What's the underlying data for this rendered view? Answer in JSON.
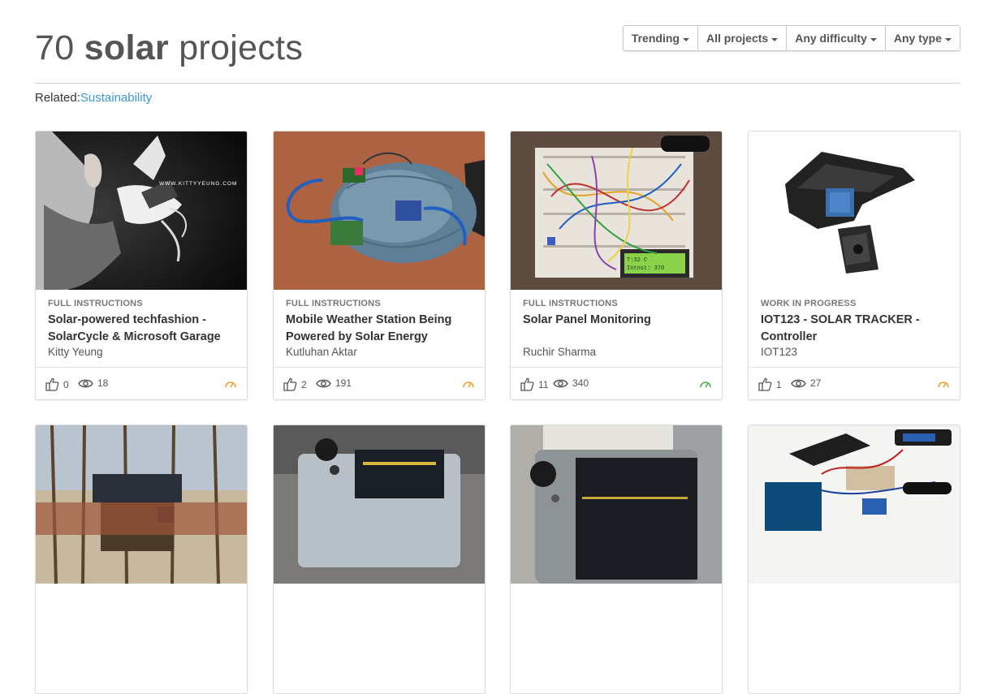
{
  "header": {
    "count": "70",
    "keyword": "solar",
    "suffix": "projects",
    "filters": [
      "Trending",
      "All projects",
      "Any difficulty",
      "Any type"
    ]
  },
  "related": {
    "label": "Related:",
    "link": "Sustainability"
  },
  "cards": [
    {
      "kind": "FULL INSTRUCTIONS",
      "title": "Solar-powered techfashion - SolarCycle & Microsoft Garage",
      "author": "Kitty Yeung",
      "likes": "0",
      "views": "18",
      "thumb_text": "WWW.KITTYYEUNG.COM",
      "indicator_color": "#f0a030"
    },
    {
      "kind": "FULL INSTRUCTIONS",
      "title": "Mobile Weather Station Being Powered by Solar Energy",
      "author": "Kutluhan Aktar",
      "likes": "2",
      "views": "191",
      "indicator_color": "#f0a030"
    },
    {
      "kind": "FULL INSTRUCTIONS",
      "title": "Solar Panel Monitoring",
      "author": "Ruchir Sharma",
      "likes": "11",
      "views": "340",
      "lcd_line1": "T:32 C",
      "lcd_line2": "Intnst: 370",
      "indicator_color": "#4caf50"
    },
    {
      "kind": "WORK IN PROGRESS",
      "title": "IOT123 - SOLAR TRACKER - Controller",
      "author": "IOT123",
      "likes": "1",
      "views": "27",
      "indicator_color": "#f0a030"
    }
  ]
}
